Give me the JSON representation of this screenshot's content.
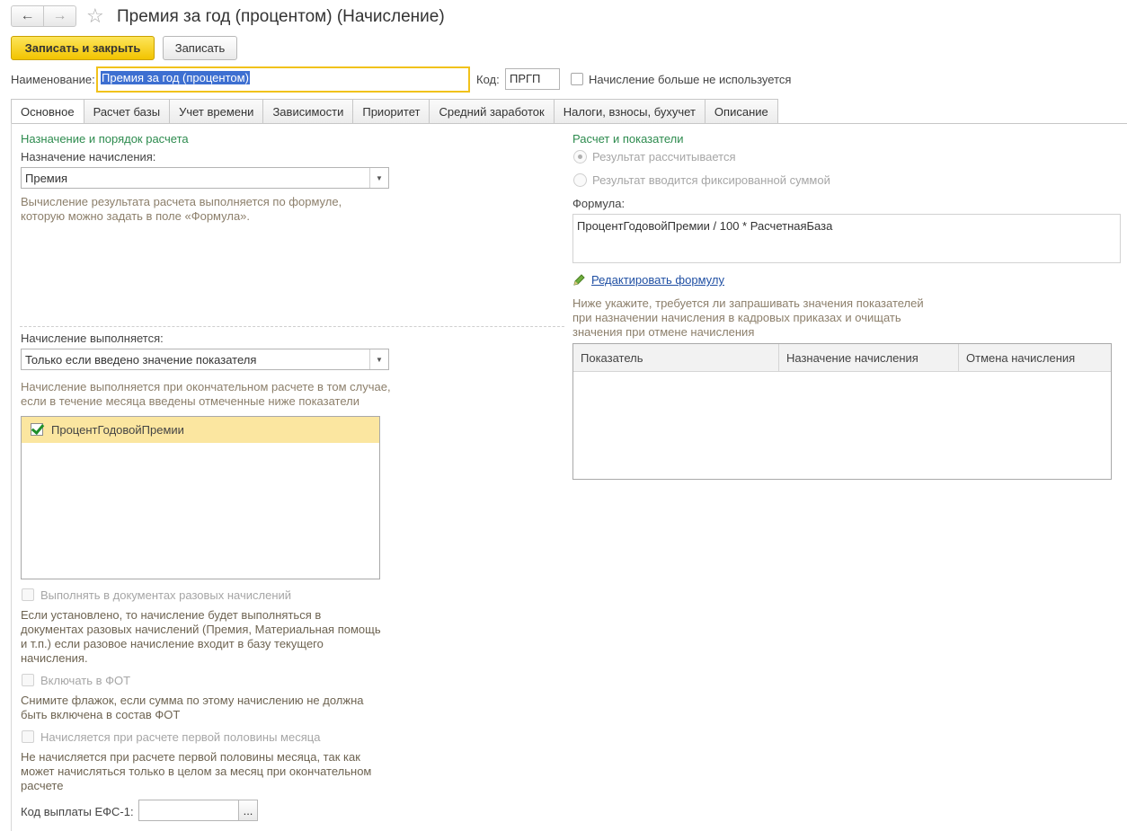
{
  "window": {
    "title": "Премия за год (процентом) (Начисление)"
  },
  "toolbar": {
    "save_close_label": "Записать и закрыть",
    "save_label": "Записать"
  },
  "header": {
    "name_label": "Наименование:",
    "name_value": "Премия за год (процентом)",
    "code_label": "Код:",
    "code_value": "ПРГП",
    "unused_label": "Начисление больше не используется"
  },
  "tabs": [
    {
      "label": "Основное"
    },
    {
      "label": "Расчет базы"
    },
    {
      "label": "Учет времени"
    },
    {
      "label": "Зависимости"
    },
    {
      "label": "Приоритет"
    },
    {
      "label": "Средний заработок"
    },
    {
      "label": "Налоги, взносы, бухучет"
    },
    {
      "label": "Описание"
    }
  ],
  "left": {
    "section_title": "Назначение и порядок расчета",
    "purpose_label": "Назначение начисления:",
    "purpose_value": "Премия",
    "purpose_hint_1": "Вычисление результата расчета выполняется по формуле,",
    "purpose_hint_2": "которую можно задать в поле «Формула».",
    "executed_label": "Начисление выполняется:",
    "executed_value": "Только если введено значение показателя",
    "executed_hint_1": "Начисление выполняется при окончательном расчете в том случае,",
    "executed_hint_2": "если в течение месяца введены отмеченные ниже показатели",
    "indicators": [
      {
        "label": "ПроцентГодовойПремии",
        "checked": true
      }
    ],
    "one_time_label": "Выполнять в документах разовых начислений",
    "one_time_hint": [
      "Если установлено, то начисление будет выполняться в",
      "документах разовых начислений (Премия, Материальная помощь",
      "и т.п.) если разовое начисление входит в базу текущего",
      "начисления."
    ],
    "fot_label": "Включать в ФОТ",
    "fot_hint": [
      "Снимите флажок, если сумма по этому начислению не должна",
      "быть включена в состав ФОТ"
    ],
    "half_label": "Начисляется при расчете первой половины месяца",
    "half_hint": [
      "Не начисляется при расчете первой половины месяца, так как",
      "может начисляться только в целом за месяц при окончательном",
      "расчете"
    ],
    "efs_label": "Код выплаты ЕФС-1:",
    "efs_value": "",
    "efs_button": "..."
  },
  "right": {
    "section_title": "Расчет и показатели",
    "radio_calc": "Результат рассчитывается",
    "radio_fixed": "Результат вводится фиксированной суммой",
    "formula_label": "Формула:",
    "formula_value": "ПроцентГодовойПремии / 100 * РасчетнаяБаза",
    "edit_formula_link": "Редактировать формулу",
    "indicators_hint": [
      "Ниже укажите, требуется ли запрашивать значения показателей",
      "при назначении начисления в кадровых приказах и очищать",
      "значения при отмене начисления"
    ],
    "grid_columns": [
      "Показатель",
      "Назначение начисления",
      "Отмена начисления"
    ]
  },
  "colors": {
    "accent_yellow": "#f2c400",
    "section_green": "#2d8b4e",
    "hint_brown": "#8c7f6b",
    "link_blue": "#1f4fa3",
    "selection_row": "#fbe6a0"
  }
}
